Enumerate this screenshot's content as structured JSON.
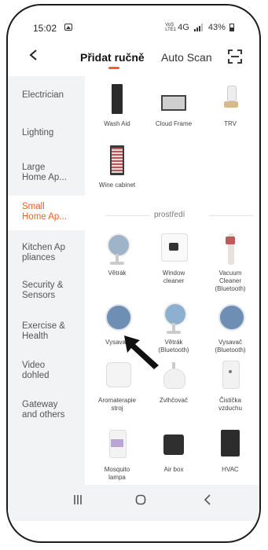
{
  "status": {
    "time": "15:02",
    "network_small_top": "VoS",
    "network_small_bottom": "LTE1",
    "network": "4G",
    "battery": "43%"
  },
  "header": {
    "tab_manual": "Přidat ručně",
    "tab_auto": "Auto Scan"
  },
  "sidebar": {
    "items": [
      {
        "label": "Electrician"
      },
      {
        "label": "Lighting"
      },
      {
        "label": "Large\nHome Ap..."
      },
      {
        "label": "Small\nHome Ap...",
        "selected": true
      },
      {
        "label": "Kitchen Ap\npliances"
      },
      {
        "label": "Security &\nSensors"
      },
      {
        "label": "Exercise &\nHealth"
      },
      {
        "label": "Video\ndohled"
      },
      {
        "label": "Gateway\nand others"
      }
    ]
  },
  "content": {
    "group1": [
      {
        "label": "Wash Aid",
        "icon": "wash-aid-icon"
      },
      {
        "label": "Cloud Frame",
        "icon": "cloud-frame-icon"
      },
      {
        "label": "TRV",
        "icon": "trv-icon"
      },
      {
        "label": "Wine cabinet",
        "icon": "wine-cabinet-icon"
      }
    ],
    "section_title": "prostředí",
    "group2": [
      {
        "label": "Větrák",
        "icon": "fan-icon"
      },
      {
        "label": "Window\ncleaner",
        "icon": "window-cleaner-icon"
      },
      {
        "label": "Vacuum\nCleaner\n(Bluetooth)",
        "icon": "vacuum-cleaner-bt-icon"
      },
      {
        "label": "Vysavač",
        "icon": "robot-vacuum-icon"
      },
      {
        "label": "Větrák\n(Bluetooth)",
        "icon": "fan-bt-icon"
      },
      {
        "label": "Vysavač\n(Bluetooth)",
        "icon": "robot-vacuum-bt-icon"
      },
      {
        "label": "Aromaterapie\nstroj",
        "icon": "aroma-diffuser-icon"
      },
      {
        "label": "Zvlhčovač",
        "icon": "humidifier-icon"
      },
      {
        "label": "Čistička\nvzduchu",
        "icon": "air-purifier-icon"
      },
      {
        "label": "Mosquito\nlampa",
        "icon": "mosquito-lamp-icon"
      },
      {
        "label": "Air box",
        "icon": "air-box-icon"
      },
      {
        "label": "HVAC",
        "icon": "hvac-icon"
      }
    ]
  },
  "colors": {
    "accent": "#ff5a1f",
    "sidebar_bg": "#f2f3f5"
  }
}
